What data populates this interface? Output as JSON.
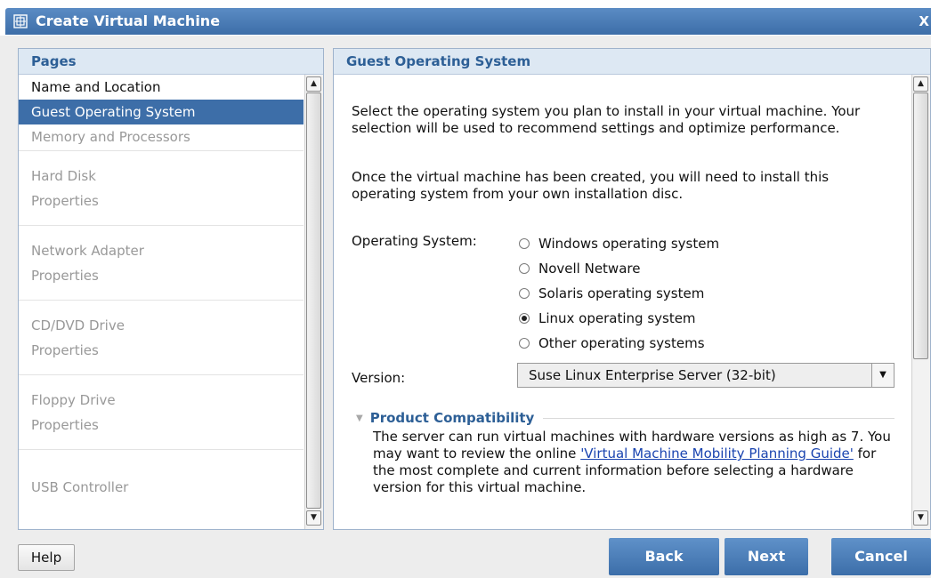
{
  "window": {
    "title": "Create Virtual Machine",
    "close_glyph": "X",
    "icon": "vm-window-icon"
  },
  "pages": {
    "header": "Pages",
    "items": [
      {
        "label": "Name and Location",
        "enabled": true
      },
      {
        "label": "Guest Operating System",
        "enabled": true,
        "selected": true
      },
      {
        "label": "Memory and Processors",
        "enabled": false
      },
      {
        "label": "Hard Disk",
        "enabled": false
      },
      {
        "label": "Properties",
        "enabled": false
      },
      {
        "label": "Network Adapter",
        "enabled": false
      },
      {
        "label": "Properties",
        "enabled": false
      },
      {
        "label": "CD/DVD Drive",
        "enabled": false
      },
      {
        "label": "Properties",
        "enabled": false
      },
      {
        "label": "Floppy Drive",
        "enabled": false
      },
      {
        "label": "Properties",
        "enabled": false
      },
      {
        "label": "USB Controller",
        "enabled": false
      }
    ]
  },
  "content": {
    "header": "Guest Operating System",
    "intro": "Select the operating system you plan to install in your virtual machine. Your selection will be used to recommend settings and optimize performance.",
    "install_note": "Once the virtual machine has been created, you will need to install this operating system from your own installation disc.",
    "os_label": "Operating System:",
    "os_options": [
      {
        "label": "Windows operating system",
        "checked": false
      },
      {
        "label": "Novell Netware",
        "checked": false
      },
      {
        "label": "Solaris operating system",
        "checked": false
      },
      {
        "label": "Linux operating system",
        "checked": true
      },
      {
        "label": "Other operating systems",
        "checked": false
      }
    ],
    "version_label": "Version:",
    "version_value": "Suse Linux Enterprise Server (32-bit)",
    "compat_header": "Product Compatibility",
    "compat_text_1": "The server can run virtual machines with hardware versions as high as 7. You may want to review the online ",
    "compat_link": "'Virtual Machine Mobility Planning Guide'",
    "compat_text_2": " for the most complete and current information before selecting a hardware version for this virtual machine."
  },
  "buttons": {
    "help": "Help",
    "back": "Back",
    "next": "Next",
    "cancel": "Cancel"
  },
  "colors": {
    "accent": "#3d6ea8",
    "header_text": "#2d5f96",
    "disabled_text": "#999999"
  }
}
